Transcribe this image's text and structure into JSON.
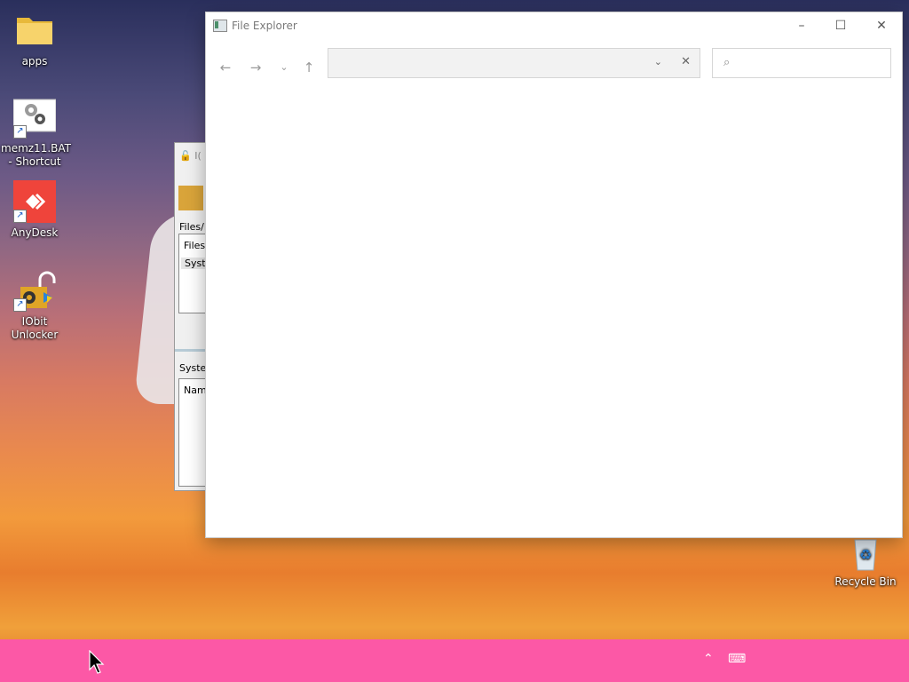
{
  "desktop": {
    "icons": [
      {
        "label": "apps"
      },
      {
        "label": "memz11.BAT - Shortcut"
      },
      {
        "label": "AnyDesk"
      },
      {
        "label": "IObit Unlocker"
      },
      {
        "label": "Recycle Bin"
      }
    ]
  },
  "background_window": {
    "title": "I(",
    "rows": [
      "Files/F",
      "Files/",
      "Syste",
      "Syster",
      "Name"
    ]
  },
  "explorer": {
    "title": "File Explorer",
    "address_value": "",
    "search_placeholder": "",
    "controls": {
      "minimize": "–",
      "maximize": "☐",
      "close": "✕"
    },
    "nav": {
      "back": "←",
      "forward": "→",
      "recent": "⌄",
      "up": "↑"
    }
  },
  "colors": {
    "taskbar": "#fc58a6",
    "accent": "#0078d7"
  },
  "icons": [
    "folder-icon",
    "gear-shortcut-icon",
    "anydesk-icon",
    "iobit-lock-icon",
    "recycle-bin-icon",
    "search-icon",
    "chevron-up-icon",
    "keyboard-icon"
  ]
}
